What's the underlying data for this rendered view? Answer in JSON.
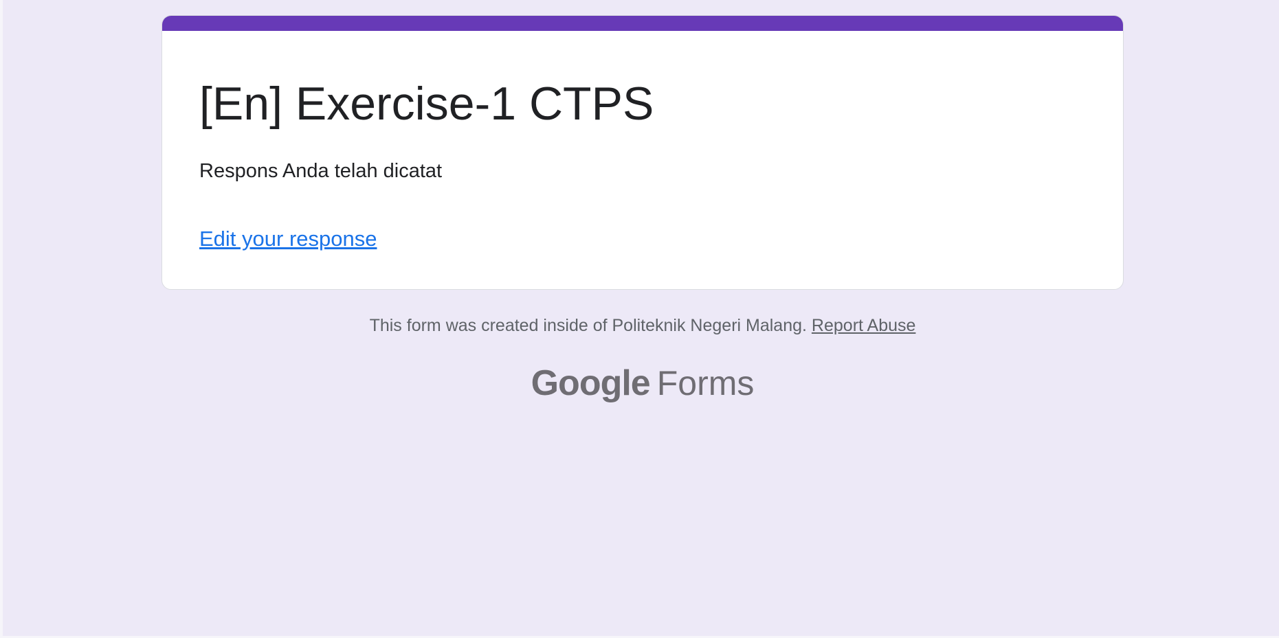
{
  "form": {
    "title": "[En] Exercise-1 CTPS",
    "confirmation_message": "Respons Anda telah dicatat",
    "edit_link_label": "Edit your response"
  },
  "footer": {
    "note": "This form was created inside of Politeknik Negeri Malang.",
    "report_link_label": "Report Abuse"
  },
  "brand": {
    "google_word": "Google",
    "product_word": "Forms"
  },
  "colors": {
    "accent": "#673ab7",
    "background": "#ede9f7",
    "link": "#1a73e8",
    "text": "#202124"
  }
}
